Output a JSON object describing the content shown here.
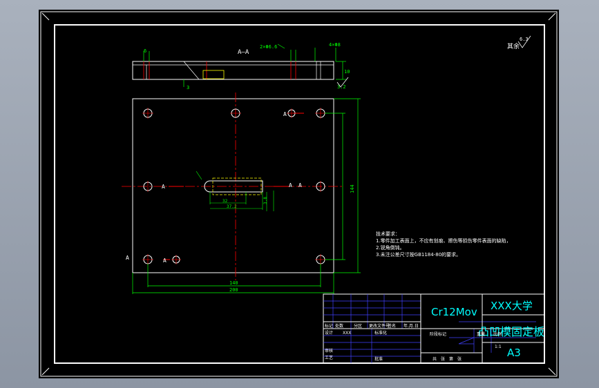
{
  "colors": {
    "background": "#000000",
    "frame": "#ffffff",
    "geometry": "#ffffff",
    "dimension": "#00ff00",
    "centerline": "#ff0000",
    "hidden": "#ffff00",
    "title_cyan": "#00ffff",
    "title_grid": "#4040ff"
  },
  "drawing": {
    "section_label": "A—A",
    "view_marker": "A",
    "roughness_note": "其余",
    "roughness_value": "6.3",
    "dims": {
      "top_hole": "2×Φ6.6",
      "top_depth": "6",
      "top_right": "4×Φ8",
      "thickness": "10",
      "chamfer": "3",
      "roughness_right": "3.2",
      "width_inner": "140",
      "width_outer": "200",
      "height_outer": "144",
      "slot_h": "3.8",
      "slot_w1": "32",
      "slot_w2": "37.2"
    }
  },
  "notes": {
    "title": "技术要求：",
    "line1": "1.零件加工表面上，不应有划痕、擦伤等损伤零件表面的缺陷，",
    "line1b": "2.锐角倒钝。",
    "line2": "3.未注公差尺寸按GB1184-80的要求。"
  },
  "title_block": {
    "material": "Cr12Mov",
    "school": "XXX大学",
    "part_name": "凸凹模固定板",
    "sheet_size": "A3",
    "labels": {
      "mark": "标记",
      "count": "处数",
      "zone": "分区",
      "doc_no": "更改文件号",
      "sign": "签名",
      "date": "年.月.日",
      "design": "设计",
      "designer": "XXX",
      "standard": "标准化",
      "stage": "阶段标记",
      "weight": "重量",
      "scale": "比例",
      "scale_val": "1:1",
      "review": "审核",
      "process": "工艺",
      "approve": "批准",
      "sheets": "共　张　第　张"
    }
  }
}
